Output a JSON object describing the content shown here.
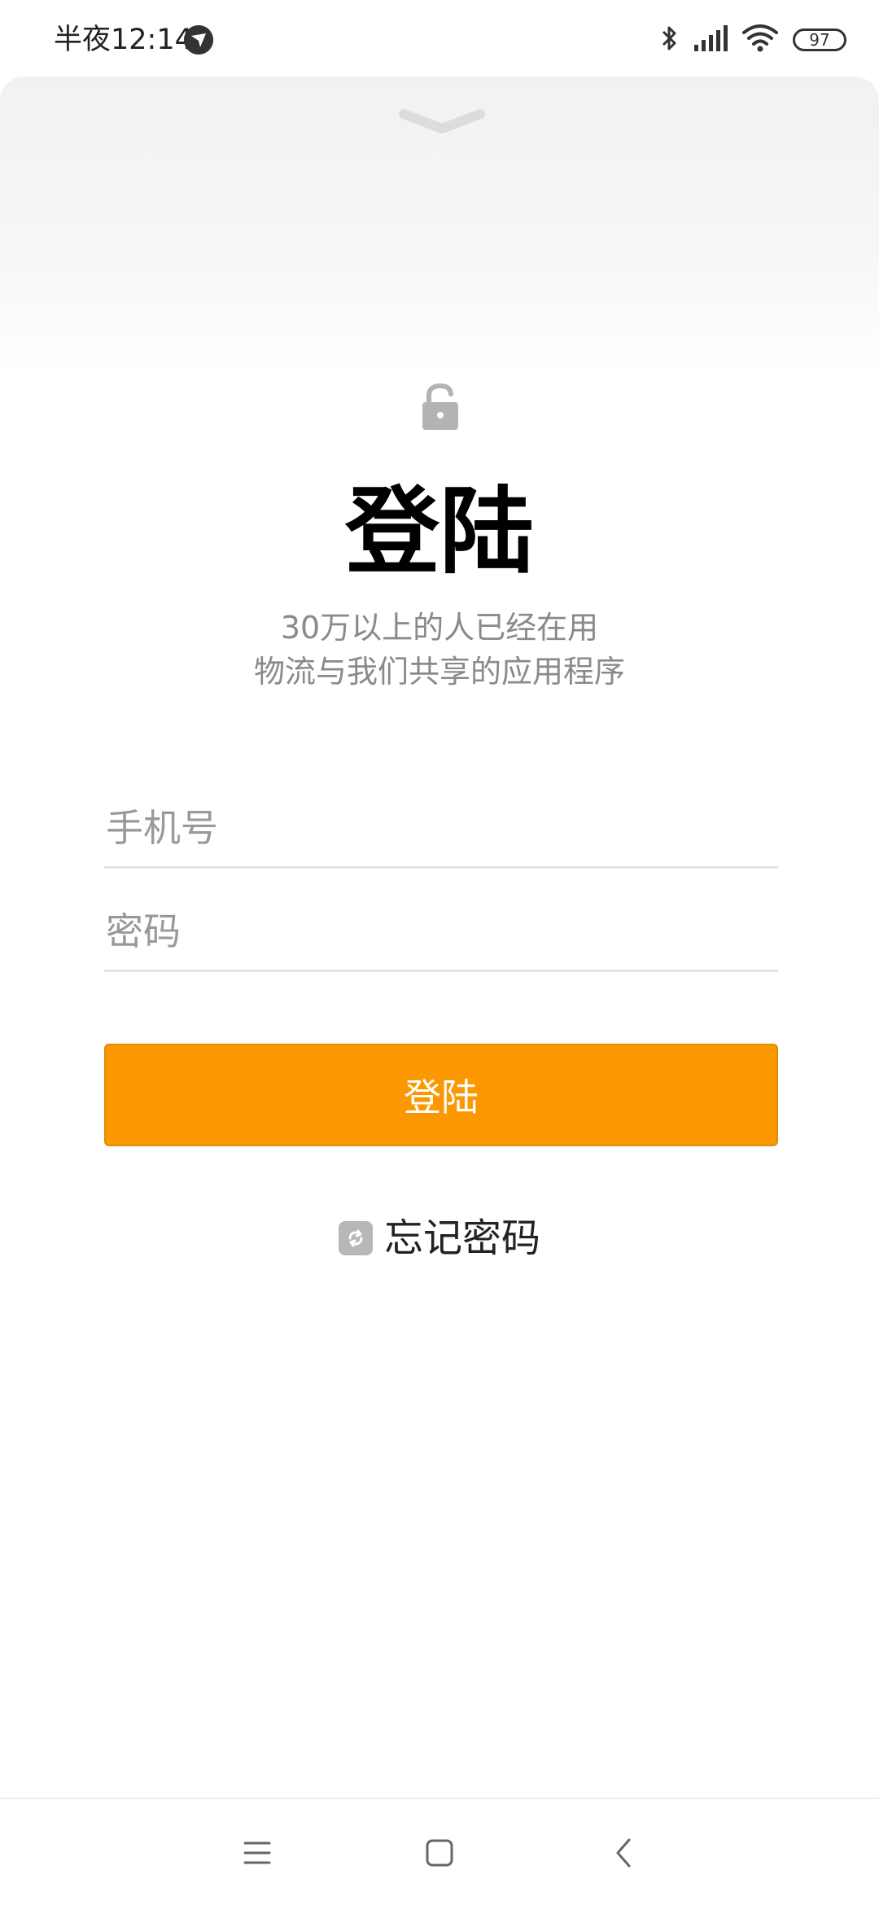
{
  "status_bar": {
    "time": "半夜12:14",
    "battery": "97"
  },
  "login": {
    "title": "登陆",
    "subtitle_line1": "30万以上的人已经在用",
    "subtitle_line2": "物流与我们共享的应用程序",
    "phone_placeholder": "手机号",
    "password_placeholder": "密码",
    "login_button": "登陆",
    "forgot_password": "忘记密码"
  },
  "colors": {
    "accent": "#fb9800",
    "subtitle": "#8a8a8a",
    "placeholder": "#999999"
  },
  "icons": {
    "status_app": "notification-app-icon",
    "bluetooth": "bluetooth-icon",
    "signal": "signal-icon",
    "wifi": "wifi-icon",
    "battery": "battery-icon",
    "handle": "chevron-down-icon",
    "lock": "lock-icon",
    "forgot": "refresh-icon",
    "nav_menu": "menu-icon",
    "nav_home": "home-icon",
    "nav_back": "back-icon"
  }
}
